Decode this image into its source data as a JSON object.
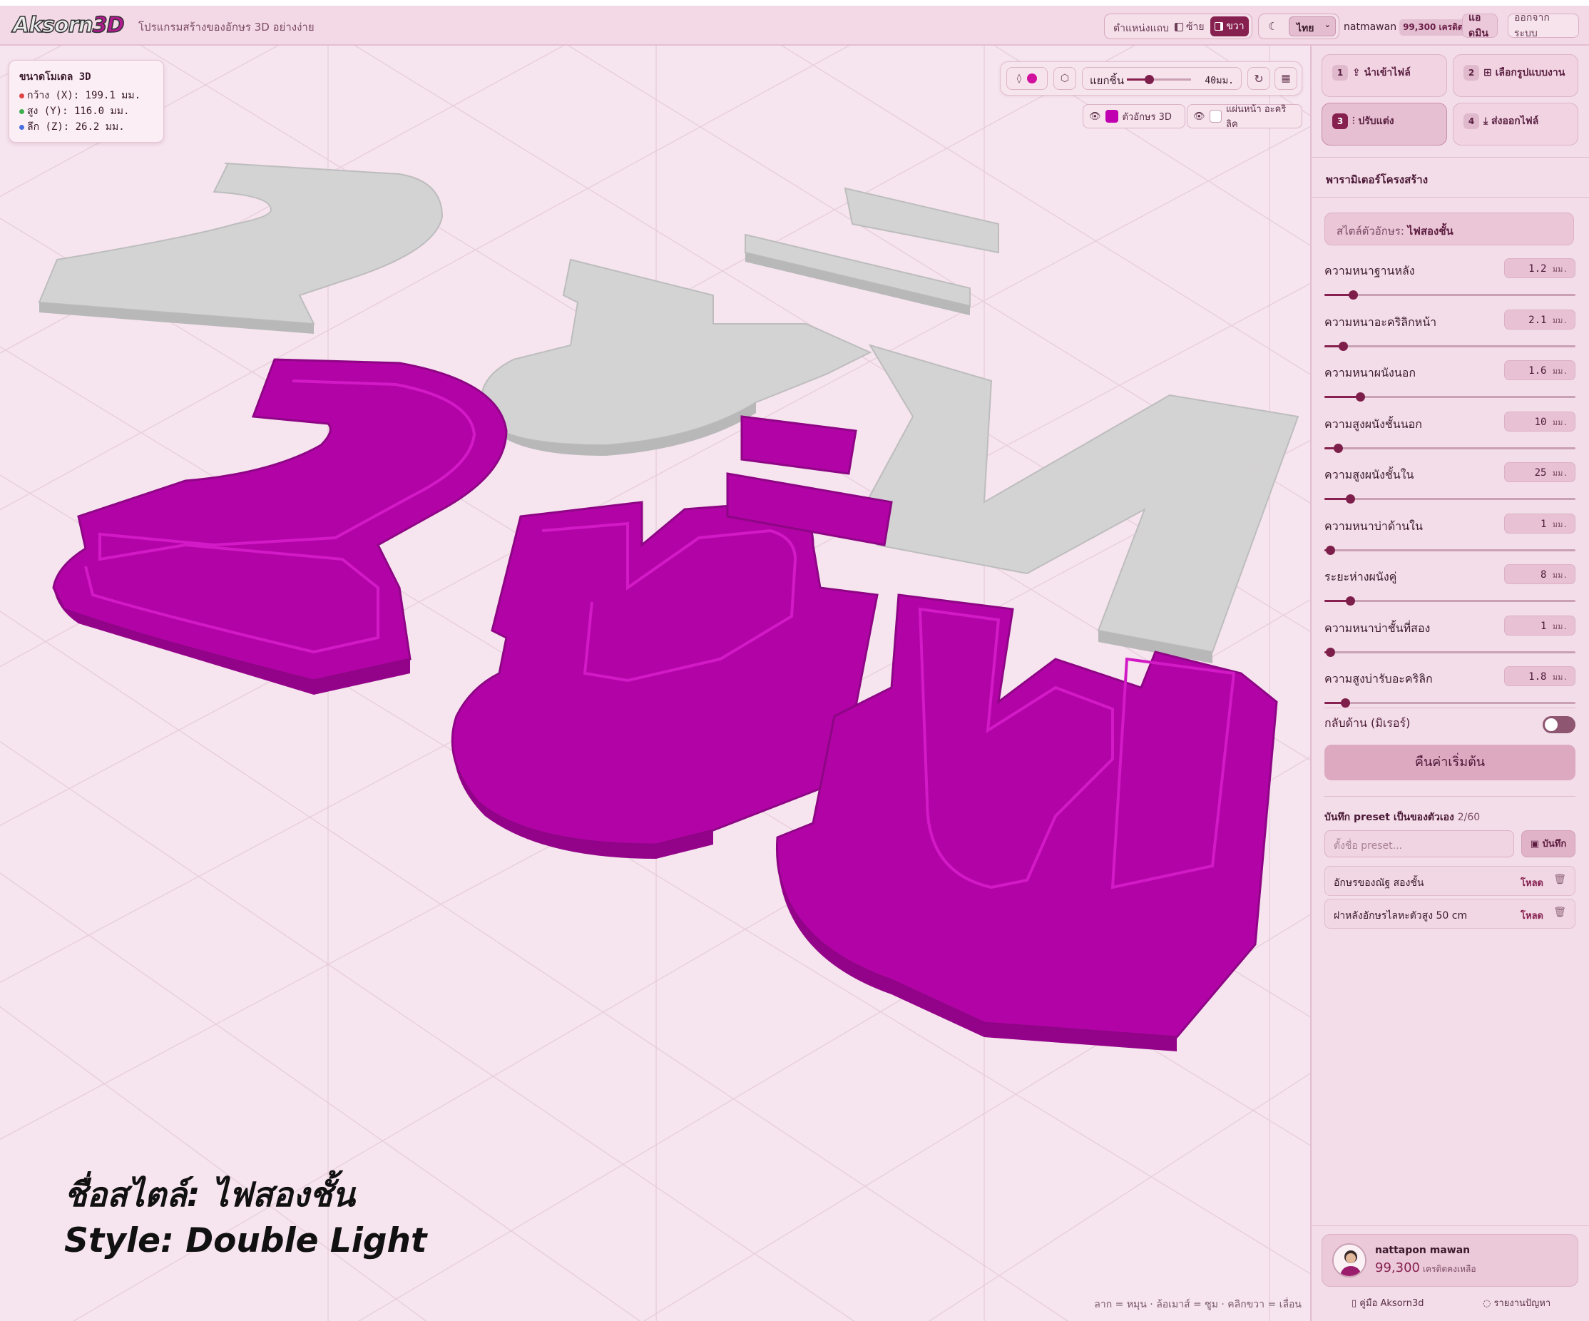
{
  "header": {
    "logo": "Aksorn",
    "logo_accent": "3D",
    "tagline": "โปรแกรมสร้างของอักษร 3D อย่างง่าย",
    "position_label": "ตำแหน่งแถบ",
    "left_label": "ซ้าย",
    "right_label": "ขวา",
    "language": "ไทย",
    "username": "natmawan",
    "credits_chip": "99,300 เครดิต",
    "admin_label": "แอดมิน",
    "logout_label": "ออกจากระบบ"
  },
  "viewport": {
    "dimensions": {
      "title": "ขนาดโมเดล 3D",
      "width": "กว้าง (X): 199.1 มม.",
      "height": "สูง (Y): 116.0 มม.",
      "depth": "ลึก (Z): 26.2 มม."
    },
    "explode_label": "แยกชิ้น",
    "explode_value": "40มม.",
    "explode_fraction": 0.35,
    "layer_letters_label": "ตัวอักษร 3D",
    "layer_acrylic_label": "แผ่นหน้า อะคริลิค",
    "letters_color": "#c000b0",
    "caption_th": "ชื่อสไตล์: ไฟสองชั้น",
    "caption_en": "Style: Double Light",
    "hint": "ลาก = หมุน · ล้อเมาส์ = ซูม · คลิกขวา = เลื่อน",
    "model_text": "2ชั้น"
  },
  "steps": [
    {
      "num": "1",
      "label": "นำเข้าไฟล์",
      "icon": "upload-icon"
    },
    {
      "num": "2",
      "label": "เลือกรูปแบบงาน",
      "icon": "grid-icon"
    },
    {
      "num": "3",
      "label": "ปรับแต่ง",
      "icon": "sliders-icon"
    },
    {
      "num": "4",
      "label": "ส่งออกไฟล์",
      "icon": "download-icon"
    }
  ],
  "panel": {
    "section_title": "พารามิเตอร์โครงสร้าง",
    "style_label": "สไตล์ตัวอักษร:",
    "style_value": "ไฟสองชั้น",
    "params": [
      {
        "label": "ความหนาฐานหลัง",
        "value": "1.2",
        "unit": "มม.",
        "level": 0.09
      },
      {
        "label": "ความหนาอะคริลิกหน้า",
        "value": "2.1",
        "unit": "มม.",
        "level": 0.05
      },
      {
        "label": "ความหนาผนังนอก",
        "value": "1.6",
        "unit": "มม.",
        "level": 0.12
      },
      {
        "label": "ความสูงผนังชั้นนอก",
        "value": "10",
        "unit": "มม.",
        "level": 0.03
      },
      {
        "label": "ความสูงผนังชั้นใน",
        "value": "25",
        "unit": "มม.",
        "level": 0.08
      },
      {
        "label": "ความหนาบ่าด้านใน",
        "value": "1",
        "unit": "มม.",
        "level": 0.0
      },
      {
        "label": "ระยะห่างผนังคู่",
        "value": "8",
        "unit": "มม.",
        "level": 0.08
      },
      {
        "label": "ความหนาบ่าชั้นที่สอง",
        "value": "1",
        "unit": "มม.",
        "level": 0.0
      },
      {
        "label": "ความสูงบ่ารับอะคริลิก",
        "value": "1.8",
        "unit": "มม.",
        "level": 0.06
      }
    ],
    "mirror_label": "กลับด้าน (มิเรอร์)",
    "reset_label": "คืนค่าเริ่มต้น",
    "preset_title": "บันทึก preset เป็นของตัวเอง",
    "preset_count": "2/60",
    "preset_placeholder": "ตั้งชื่อ preset...",
    "preset_save": "บันทึก",
    "presets": [
      {
        "name": "อักษรของณัฐ สองชั้น",
        "load": "โหลด"
      },
      {
        "name": "ฝาหลังอักษรไลหะตัวสูง 50 cm",
        "load": "โหลด"
      }
    ],
    "user": {
      "name": "nattapon mawan",
      "credits": "99,300",
      "credits_suffix": "เครดิตคงเหลือ"
    },
    "footer_manual": "คู่มือ Aksorn3d",
    "footer_report": "รายงานปัญหา"
  }
}
